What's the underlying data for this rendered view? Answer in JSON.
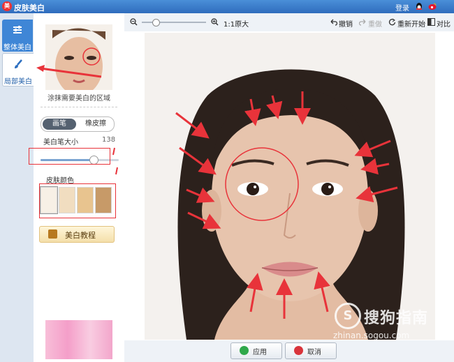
{
  "window": {
    "title": "皮肤美白",
    "login": "登录",
    "logo_text": "美"
  },
  "nav": [
    {
      "label": "整体美白",
      "icon": "sliders-icon",
      "active": false
    },
    {
      "label": "局部美白",
      "icon": "brush-icon",
      "active": true
    }
  ],
  "panel": {
    "hint": "涂抹需要美白的区域",
    "modes": [
      "画笔",
      "橡皮擦"
    ],
    "selected_mode": "画笔",
    "brush_size_label": "美白笔大小",
    "brush_size_value": "138",
    "brush_size_fraction": 0.68,
    "skin_color_label": "皮肤颜色",
    "skin_colors": [
      "#f7f0e6",
      "#f1ddc0",
      "#e8c48f",
      "#c79a68"
    ],
    "tutorial_label": "美白教程"
  },
  "toolbar": {
    "zoom_fraction": 0.22,
    "ratio_label": "1:1原大",
    "undo_label": "撤销",
    "redo_label": "重做",
    "restart_label": "重新开始",
    "compare_label": "对比"
  },
  "footer": {
    "apply_label": "应用",
    "cancel_label": "取消"
  },
  "watermark": {
    "logo": "S",
    "text": "搜狗指南",
    "url": "zhinan.sogou.com"
  },
  "colors": {
    "titlebar": "#2f6cbd",
    "annotation_red": "#e8333a",
    "skin": "#e7c7b3"
  }
}
